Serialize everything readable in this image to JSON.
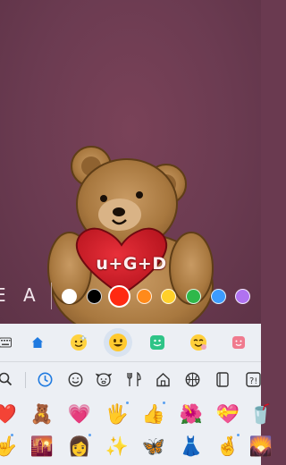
{
  "canvas": {
    "background": "#6b3b51",
    "sticker": {
      "heart_text": "u+G+D"
    }
  },
  "text_toolbar": {
    "style_label": "E",
    "font_label": "A",
    "colors": [
      "#ffffff",
      "#000000",
      "#ff2a12",
      "#ff8a1a",
      "#ffd02a",
      "#2fb84a",
      "#3c9cff",
      "#b072f0"
    ],
    "selected_color": "#ff2a12"
  },
  "keyboard": {
    "top_tabs": [
      "keyboard-icon",
      "home-icon",
      "sparkle-emoji-icon",
      "emoji-icon",
      "sticker-icon",
      "memoji-icon",
      "app-icon"
    ],
    "selected_tab": "emoji-icon",
    "categories": [
      "search-icon",
      "recent-icon",
      "smiley-icon",
      "animal-icon",
      "food-icon",
      "building-icon",
      "ball-icon",
      "object-icon",
      "symbol-icon"
    ],
    "active_category": "recent-icon",
    "emoji_rows": [
      [
        "❤️",
        "🧸",
        "💗",
        "🖐️",
        "👍",
        "🌺",
        "💝",
        "🥤"
      ],
      [
        "🤟",
        "🌇",
        "👩",
        "✨",
        "🦋",
        "👗",
        "🤞",
        "🌄"
      ]
    ]
  }
}
